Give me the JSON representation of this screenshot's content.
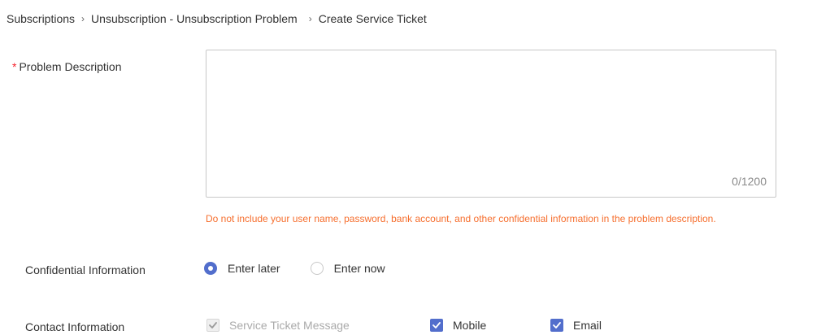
{
  "breadcrumb": {
    "items": [
      "Subscriptions",
      "Unsubscription - Unsubscription Problem"
    ],
    "current": "Create Service Ticket",
    "separator": "›"
  },
  "problem_description": {
    "required_mark": "*",
    "label": "Problem Description",
    "value": "",
    "char_count": "0/1200",
    "warning": "Do not include your user name, password, bank account, and other confidential information in the problem description."
  },
  "confidential": {
    "label": "Confidential Information",
    "options": [
      {
        "label": "Enter later",
        "selected": true
      },
      {
        "label": "Enter now",
        "selected": false
      }
    ]
  },
  "contact": {
    "label": "Contact Information",
    "options": [
      {
        "label": "Service Ticket Message",
        "checked": true,
        "disabled": true
      },
      {
        "label": "Mobile",
        "checked": true,
        "disabled": false
      },
      {
        "label": "Email",
        "checked": true,
        "disabled": false
      }
    ]
  },
  "colors": {
    "accent": "#526ecc",
    "warning": "#f66f2f",
    "required": "#f5222d"
  }
}
